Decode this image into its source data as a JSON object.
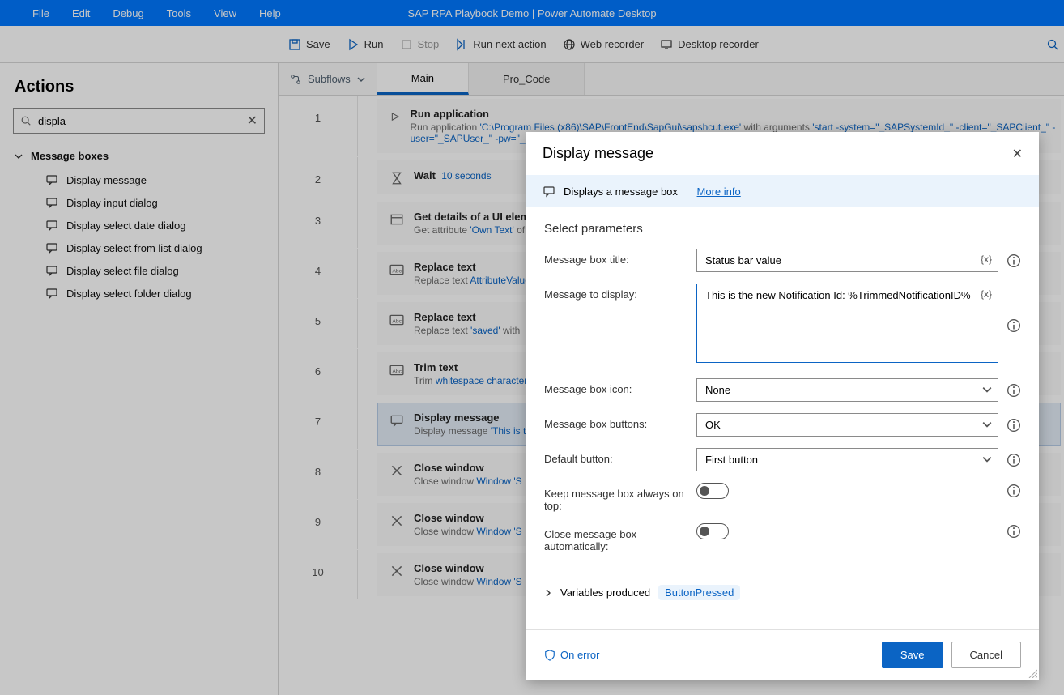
{
  "titlebar": {
    "menus": [
      "File",
      "Edit",
      "Debug",
      "Tools",
      "View",
      "Help"
    ],
    "title": "SAP RPA Playbook Demo | Power Automate Desktop"
  },
  "toolbar": {
    "save": "Save",
    "run": "Run",
    "stop": "Stop",
    "run_next": "Run next action",
    "web_rec": "Web recorder",
    "desk_rec": "Desktop recorder"
  },
  "sidebar": {
    "title": "Actions",
    "search_value": "displa",
    "group": "Message boxes",
    "items": [
      "Display message",
      "Display input dialog",
      "Display select date dialog",
      "Display select from list dialog",
      "Display select file dialog",
      "Display select folder dialog"
    ]
  },
  "tabs": {
    "subflows": "Subflows",
    "main": "Main",
    "proc": "Pro_Code"
  },
  "steps": [
    {
      "n": "1",
      "title": "Run application",
      "sub_pre": "Run application ",
      "v": "'C:\\Program Files (x86)\\SAP\\FrontEnd\\SapGui\\sapshcut.exe'",
      "sub_mid": " with arguments ",
      "v2": "'start -system=\"_SAPSystemId_\" -client=\"_SAPClient_\" -user=\"_SAPUser_\" -pw=\"_SAPPassword_\" -maxgui'",
      "icon": "play"
    },
    {
      "n": "2",
      "title": "Wait",
      "title_extra": "10 seconds",
      "icon": "hourglass"
    },
    {
      "n": "3",
      "title": "Get details of a UI element in window",
      "sub_pre": "Get attribute ",
      "v": "'Own Text'",
      "sub_mid": " of",
      "icon": "panel"
    },
    {
      "n": "4",
      "title": "Replace text",
      "sub_pre": "Replace text  ",
      "v": "AttributeValue",
      "icon": "abc"
    },
    {
      "n": "5",
      "title": "Replace text",
      "sub_pre": "Replace text ",
      "v": "'saved'",
      "sub_mid": " with ",
      "icon": "abc"
    },
    {
      "n": "6",
      "title": "Trim text",
      "sub_pre": "Trim ",
      "v": "whitespace characters",
      "icon": "abc"
    },
    {
      "n": "7",
      "title": "Display message",
      "sub_pre": "Display message ",
      "v": "'This is the",
      "icon": "msg",
      "active": true
    },
    {
      "n": "8",
      "title": "Close window",
      "sub_pre": "Close window ",
      "v": "Window 'S",
      "icon": "x"
    },
    {
      "n": "9",
      "title": "Close window",
      "sub_pre": "Close window ",
      "v": "Window 'S",
      "icon": "x"
    },
    {
      "n": "10",
      "title": "Close window",
      "sub_pre": "Close window ",
      "v": "Window 'S",
      "icon": "x"
    }
  ],
  "dialog": {
    "title": "Display message",
    "info": "Displays a message box",
    "info_link": "More info",
    "section": "Select parameters",
    "fields": {
      "title_lbl": "Message box title:",
      "title_val": "Status bar value",
      "msg_lbl": "Message to display:",
      "msg_val": "This is the new Notification Id: %TrimmedNotificationID%",
      "icon_lbl": "Message box icon:",
      "icon_val": "None",
      "btns_lbl": "Message box buttons:",
      "btns_val": "OK",
      "def_lbl": "Default button:",
      "def_val": "First button",
      "top_lbl": "Keep message box always on top:",
      "auto_lbl": "Close message box automatically:"
    },
    "vars_lbl": "Variables produced",
    "vars_val": "ButtonPressed",
    "on_error": "On error",
    "save": "Save",
    "cancel": "Cancel"
  }
}
